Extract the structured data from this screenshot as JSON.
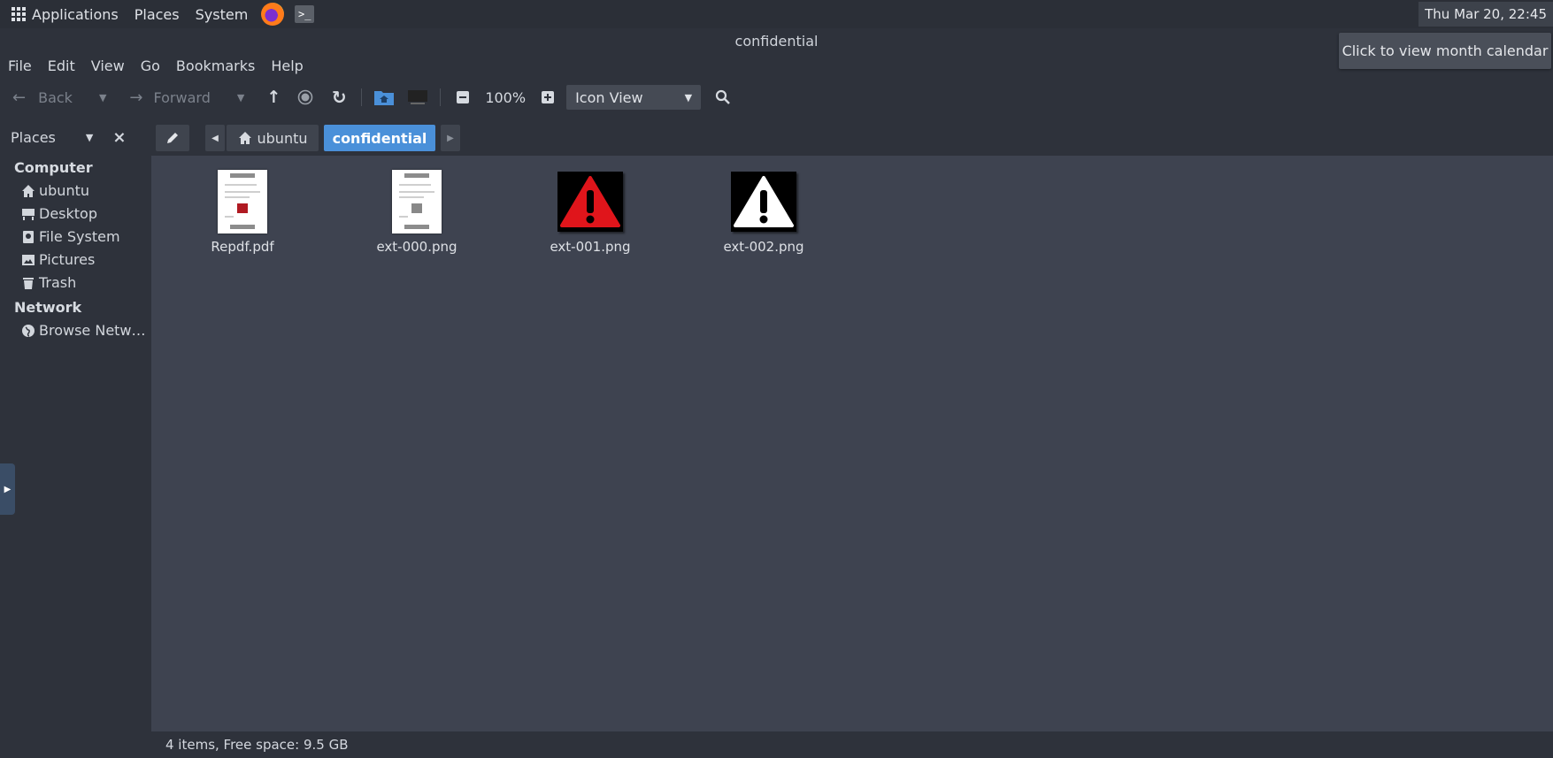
{
  "top_panel": {
    "applications_label": "Applications",
    "places_label": "Places",
    "system_label": "System",
    "terminal_glyph": ">_",
    "clock": "Thu Mar 20, 22:45"
  },
  "window": {
    "title": "confidential",
    "tooltip": "Click to view month calendar"
  },
  "menu": [
    "File",
    "Edit",
    "View",
    "Go",
    "Bookmarks",
    "Help"
  ],
  "toolbar": {
    "back_label": "Back",
    "forward_label": "Forward",
    "zoom_level": "100%",
    "view_mode": "Icon View"
  },
  "sidebar": {
    "header": "Places",
    "computer_section": "Computer",
    "computer_items": [
      "ubuntu",
      "Desktop",
      "File System",
      "Pictures",
      "Trash"
    ],
    "network_section": "Network",
    "network_items": [
      "Browse Netw…"
    ]
  },
  "path_bar": {
    "crumbs": [
      "ubuntu",
      "confidential"
    ]
  },
  "files": [
    {
      "name": "Repdf.pdf",
      "kind": "pdf-thumbnail"
    },
    {
      "name": "ext-000.png",
      "kind": "document-thumbnail"
    },
    {
      "name": "ext-001.png",
      "kind": "red-warning-icon"
    },
    {
      "name": "ext-002.png",
      "kind": "white-warning-icon"
    }
  ],
  "status": {
    "text": "4 items, Free space: 9.5 GB"
  },
  "colors": {
    "accent": "#4a90d9",
    "main_bg": "#3e4350",
    "panel_bg": "#2e323b",
    "warning_red": "#e0151b"
  }
}
